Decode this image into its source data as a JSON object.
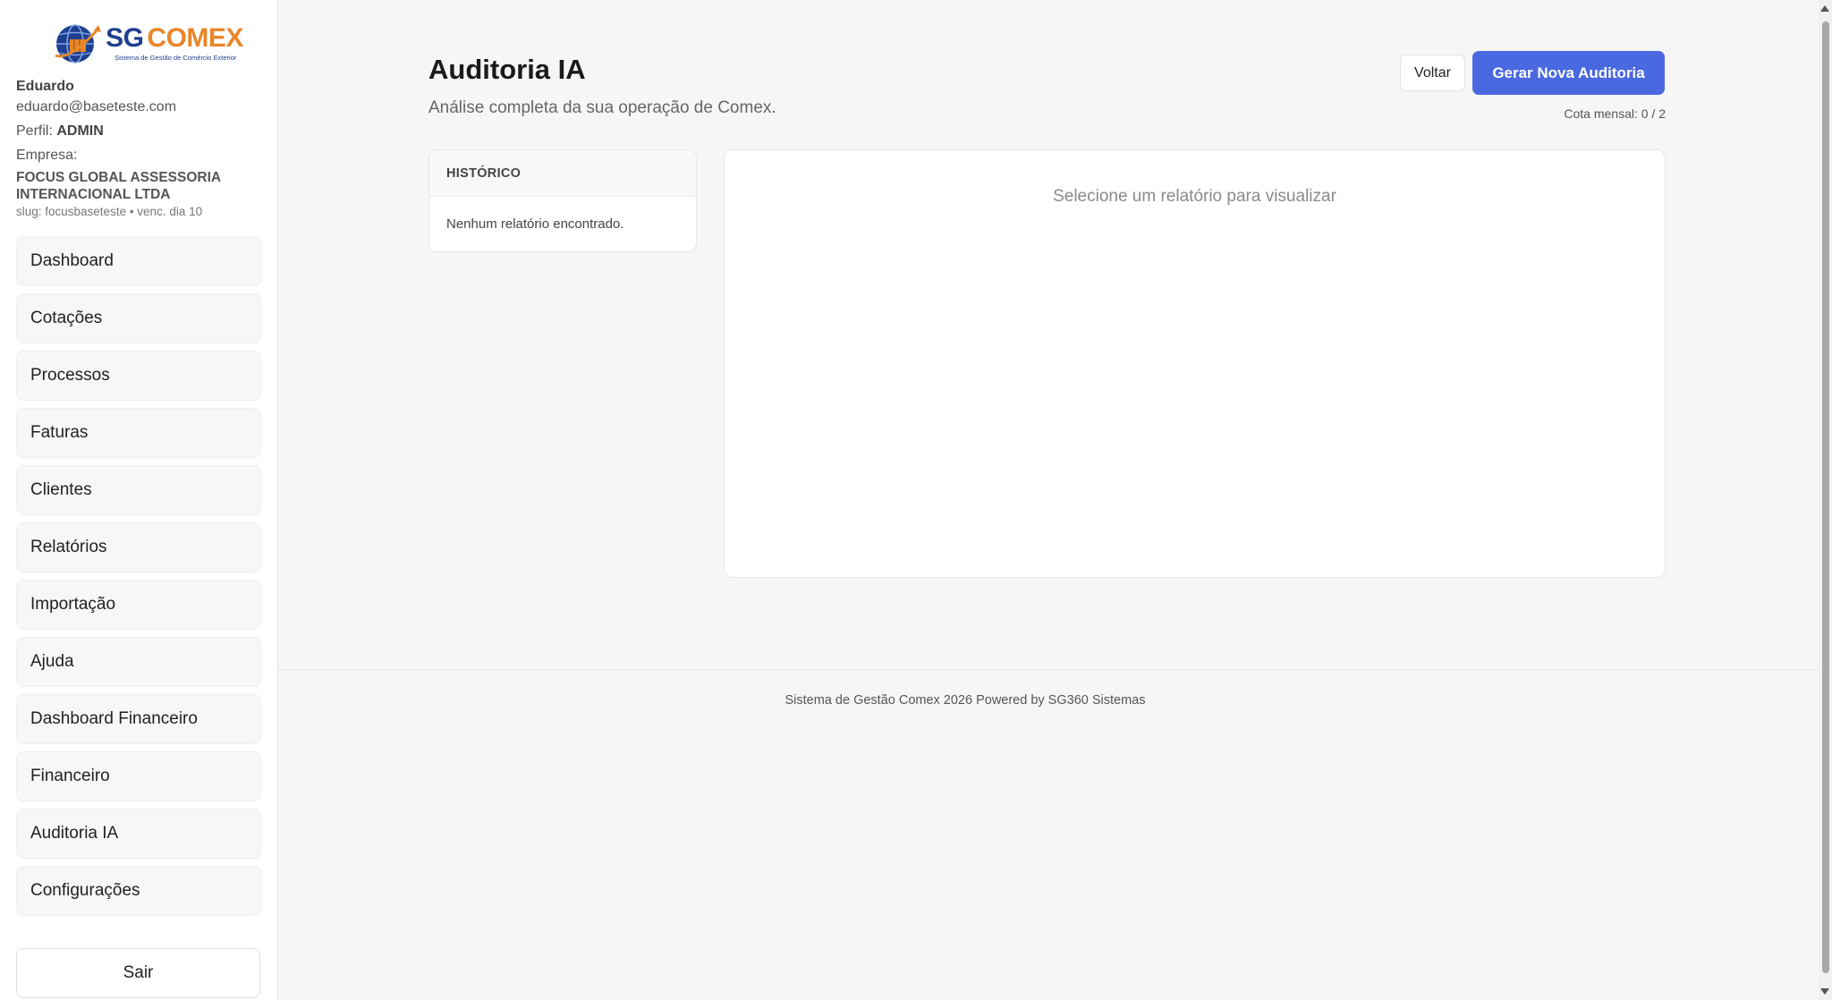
{
  "brand": {
    "name_part1": "SG",
    "name_part2": "COMEX",
    "tagline": "Sistema de Gestão de Comércio Exterior",
    "colors": {
      "primary": "#1e3f8f",
      "accent": "#e8862a"
    }
  },
  "user": {
    "name": "Eduardo",
    "email": "eduardo@baseteste.com",
    "role_label": "Perfil:",
    "role": "ADMIN",
    "company_label": "Empresa:",
    "company_name": "FOCUS GLOBAL ASSESSORIA INTERNACIONAL LTDA",
    "slug_info": "slug: focusbaseteste • venc. dia 10"
  },
  "nav": {
    "items": [
      {
        "label": "Dashboard"
      },
      {
        "label": "Cotações"
      },
      {
        "label": "Processos"
      },
      {
        "label": "Faturas"
      },
      {
        "label": "Clientes"
      },
      {
        "label": "Relatórios"
      },
      {
        "label": "Importação"
      },
      {
        "label": "Ajuda"
      },
      {
        "label": "Dashboard Financeiro"
      },
      {
        "label": "Financeiro"
      },
      {
        "label": "Auditoria IA"
      },
      {
        "label": "Configurações"
      }
    ],
    "logout_label": "Sair"
  },
  "page": {
    "title": "Auditoria IA",
    "subtitle": "Análise completa da sua operação de Comex.",
    "back_label": "Voltar",
    "generate_label": "Gerar Nova Auditoria",
    "quota": "Cota mensal: 0 / 2",
    "accent_color": "#4a68e0"
  },
  "history": {
    "title": "HISTÓRICO",
    "empty": "Nenhum relatório encontrado."
  },
  "viewer": {
    "placeholder": "Selecione um relatório para visualizar"
  },
  "footer": {
    "text": "Sistema de Gestão Comex 2026 Powered by SG360 Sistemas"
  }
}
